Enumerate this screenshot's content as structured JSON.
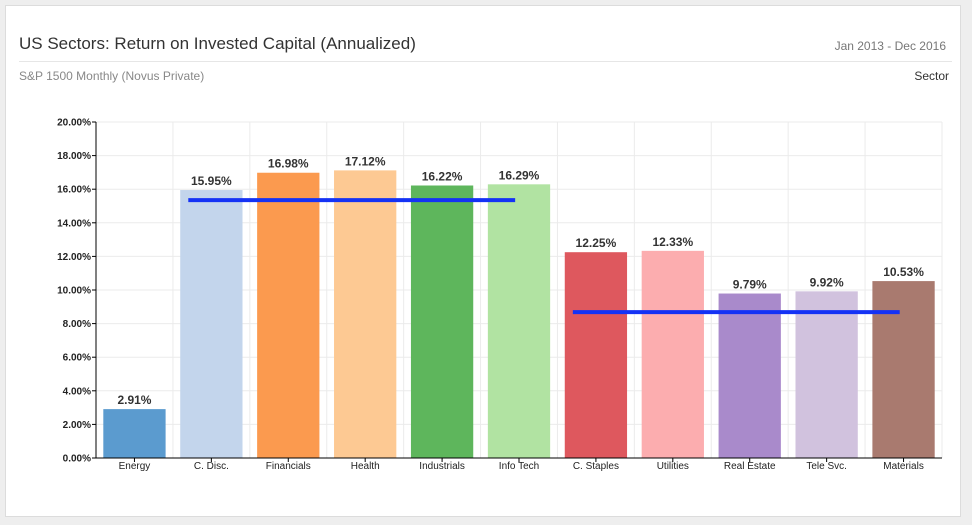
{
  "header": {
    "title": "US Sectors: Return on Invested Capital (Annualized)",
    "date_range": "Jan 2013 - Dec 2016",
    "subtitle": "S&P 1500 Monthly (Novus Private)",
    "group_by": "Sector"
  },
  "chart_data": {
    "type": "bar",
    "title": "US Sectors: Return on Invested Capital (Annualized)",
    "xlabel": "",
    "ylabel": "",
    "ylim": [
      0,
      20
    ],
    "yticks": [
      "0.00%",
      "2.00%",
      "4.00%",
      "6.00%",
      "8.00%",
      "10.00%",
      "12.00%",
      "14.00%",
      "16.00%",
      "18.00%",
      "20.00%"
    ],
    "grid": true,
    "categories": [
      "Energy",
      "C. Disc.",
      "Financials",
      "Health",
      "Industrials",
      "Info Tech",
      "C. Staples",
      "Utilities",
      "Real Estate",
      "Tele Svc.",
      "Materials"
    ],
    "values": [
      2.91,
      15.95,
      16.98,
      17.12,
      16.22,
      16.29,
      12.25,
      12.33,
      9.79,
      9.92,
      10.53
    ],
    "value_labels": [
      "2.91%",
      "15.95%",
      "16.98%",
      "17.12%",
      "16.22%",
      "16.29%",
      "12.25%",
      "12.33%",
      "9.79%",
      "9.92%",
      "10.53%"
    ],
    "colors": [
      "#5b9bcf",
      "#c3d5ec",
      "#fb9a4f",
      "#fdc993",
      "#5eb65c",
      "#b1e3a2",
      "#de585e",
      "#fcadaf",
      "#a98acb",
      "#d1c2de",
      "#a97a6f"
    ],
    "reference_lines": [
      {
        "from_category": "C. Disc.",
        "to_category": "Info Tech",
        "value": 15.35,
        "color": "#1432f5"
      },
      {
        "from_category": "C. Staples",
        "to_category": "Materials",
        "value": 8.68,
        "color": "#1432f5"
      }
    ]
  }
}
